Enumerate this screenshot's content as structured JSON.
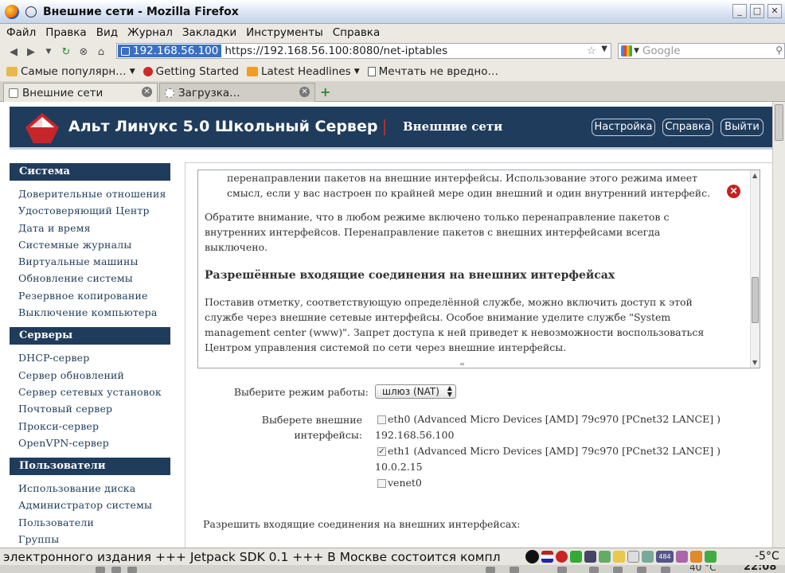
{
  "window": {
    "title": "Внешние сети - Mozilla Firefox"
  },
  "menubar": [
    "Файл",
    "Правка",
    "Вид",
    "Журнал",
    "Закладки",
    "Инструменты",
    "Справка"
  ],
  "navbar": {
    "url_host": "192.168.56.100",
    "url": "https://192.168.56.100:8080/net-iptables",
    "search_placeholder": "Google"
  },
  "bookmarks": [
    "Самые популярн…",
    "Getting Started",
    "Latest Headlines",
    "Мечтать не вредно…"
  ],
  "tabs": [
    {
      "label": "Внешние сети"
    },
    {
      "label": "Загрузка…"
    }
  ],
  "header": {
    "brand": "Альт Линукс 5.0 Школьный Сервер",
    "section": "Внешние сети",
    "buttons": [
      "Настройка",
      "Справка",
      "Выйти"
    ]
  },
  "sidebar": [
    {
      "title": "Система",
      "items": [
        "Доверительные отношения",
        "Удостоверяющий Центр",
        "Дата и время",
        "Системные журналы",
        "Виртуальные машины",
        "Обновление системы",
        "Резервное копирование",
        "Выключение компьютера"
      ]
    },
    {
      "title": "Серверы",
      "items": [
        "DHCP-сервер",
        "Сервер обновлений",
        "Сервер сетевых установок",
        "Почтовый сервер",
        "Прокси-сервер",
        "OpenVPN-сервер"
      ]
    },
    {
      "title": "Пользователи",
      "items": [
        "Использование диска",
        "Администратор системы",
        "Пользователи",
        "Группы"
      ]
    }
  ],
  "help": {
    "p1_line1": "перенаправлении пакетов на внешние интерфейсы. Использование этого режима имеет",
    "p1_line2": "смысл, если у вас настроен по крайней мере один внешний и один внутренний интерфейс.",
    "p2_line1": "Обратите внимание, что в любом режиме включено только перенаправление пакетов с",
    "p2_line2": "внутренних интерфейсов. Перенаправление пакетов с внешних интерфейсами всегда",
    "p2_line3": "выключено.",
    "heading": "Разрешённые входящие соединения на внешних интерфейсах",
    "p3_line1": "Поставив отметку, соответствующую определённой службе, можно включить доступ к этой",
    "p3_line2": "службе через внешние сетевые интерфейсы. Особое внимание уделите службе \"System",
    "p3_line3": "management center (www)\". Запрет доступа к ней приведет к невозможности воспользоваться",
    "p3_line4": "Центром управления системой по сети через внешние интерфейсы."
  },
  "form": {
    "mode_label": "Выберите режим работы:",
    "mode_value": "шлюз (NAT)",
    "iface_label_1": "Выберете внешние",
    "iface_label_2": "интерфейсы:",
    "interfaces": [
      {
        "name": "eth0 (Advanced Micro Devices [AMD] 79c970 [PCnet32 LANCE] )",
        "ip": "192.168.56.100",
        "checked": false
      },
      {
        "name": "eth1 (Advanced Micro Devices [AMD] 79c970 [PCnet32 LANCE] )",
        "ip": "10.0.2.15",
        "checked": true
      },
      {
        "name": "venet0",
        "ip": "",
        "checked": false
      }
    ],
    "incoming_label": "Разрешить входящие соединения на внешних интерфейсах:"
  },
  "statusbar": {
    "ticker": "электронного издания +++  Jetpack SDK 0.1 +++  В Москве состоится компл",
    "temperature": "-5°C",
    "tray_badge": "484"
  },
  "taskbar": {
    "temp": "40 °C",
    "clock": "22:08"
  },
  "colors": {
    "header_bg": "#1f3c5c",
    "link": "#1f3c5c",
    "close_red": "#c81e1e"
  }
}
